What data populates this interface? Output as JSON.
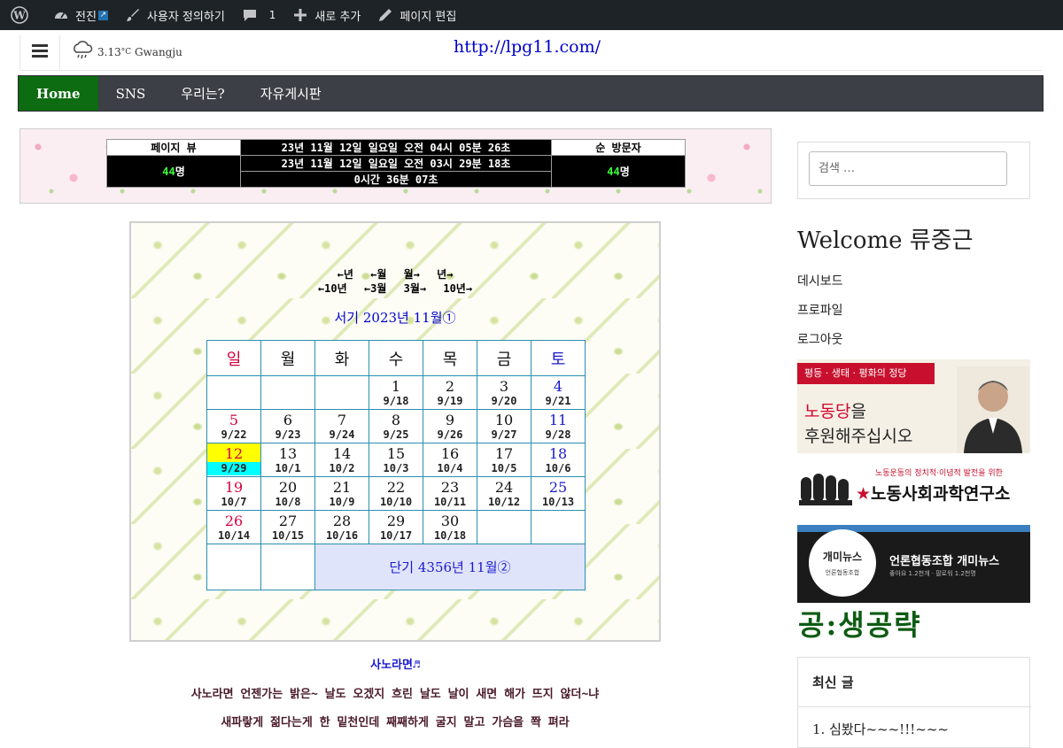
{
  "adminbar": {
    "site_name": "전진",
    "customize": "사용자 정의하기",
    "comments_count": "1",
    "new": "새로 추가",
    "edit_page": "페이지 편집"
  },
  "header": {
    "weather_temp": "3.13",
    "weather_unit": "°C",
    "weather_city": "Gwangju",
    "site_url": "http://lpg11.com/"
  },
  "nav": {
    "items": [
      {
        "label": "Home"
      },
      {
        "label": "SNS"
      },
      {
        "label": "우리는?"
      },
      {
        "label": "자유게시판"
      }
    ]
  },
  "counter": {
    "pageview_label": "페이지 뷰",
    "pageview_value": "44",
    "unit": "명",
    "now_time": "23년 11월 12일 일요일 오전 04시 05분 26초",
    "start_time": "23년 11월 12일 일요일 오전 03시 29분 18초",
    "elapsed": "0시간 36분 07초",
    "visitors_label": "순 방문자",
    "visitors_value": "44"
  },
  "calendar": {
    "nav_row1": [
      "←년",
      "←월",
      "월→",
      "년→"
    ],
    "nav_row2": [
      "←10년",
      "←3월",
      "3월→",
      "10년→"
    ],
    "title": "서기 2023년 11월①",
    "weekdays": [
      "일",
      "월",
      "화",
      "수",
      "목",
      "금",
      "토"
    ],
    "weeks": [
      [
        null,
        null,
        null,
        [
          "1",
          "9/18"
        ],
        [
          "2",
          "9/19"
        ],
        [
          "3",
          "9/20"
        ],
        [
          "4",
          "9/21"
        ]
      ],
      [
        [
          "5",
          "9/22"
        ],
        [
          "6",
          "9/23"
        ],
        [
          "7",
          "9/24"
        ],
        [
          "8",
          "9/25"
        ],
        [
          "9",
          "9/26"
        ],
        [
          "10",
          "9/27"
        ],
        [
          "11",
          "9/28"
        ]
      ],
      [
        [
          "12",
          "9/29"
        ],
        [
          "13",
          "10/1"
        ],
        [
          "14",
          "10/2"
        ],
        [
          "15",
          "10/3"
        ],
        [
          "16",
          "10/4"
        ],
        [
          "17",
          "10/5"
        ],
        [
          "18",
          "10/6"
        ]
      ],
      [
        [
          "19",
          "10/7"
        ],
        [
          "20",
          "10/8"
        ],
        [
          "21",
          "10/9"
        ],
        [
          "22",
          "10/10"
        ],
        [
          "23",
          "10/11"
        ],
        [
          "24",
          "10/12"
        ],
        [
          "25",
          "10/13"
        ]
      ],
      [
        [
          "26",
          "10/14"
        ],
        [
          "27",
          "10/15"
        ],
        [
          "28",
          "10/16"
        ],
        [
          "29",
          "10/17"
        ],
        [
          "30",
          "10/18"
        ],
        null,
        null
      ]
    ],
    "today": "12",
    "dangi": "단기 4356년 11월②"
  },
  "lyrics": {
    "title": "사노라면♬",
    "line1": "사노라면 언젠가는 밝은~ 날도 오겠지 흐린 날도 날이 새면 해가 뜨지 않더~냐",
    "line2": "새파랗게 젊다는게 한 밑천인데 째째하게 굴지 말고 가슴을 쫙 펴라"
  },
  "sidebar": {
    "search_placeholder": "검색 …",
    "welcome": "Welcome 류중근",
    "links": [
      "데시보드",
      "프로파일",
      "로그아웃"
    ],
    "banner1": {
      "top": "평등 · 생태 · 평화의 정당",
      "line1a": "노동당",
      "line1b": "을",
      "line2": "후원해주십시오"
    },
    "banner2": {
      "small": "노동운동의 정치적·이념적 발전을 위한",
      "big": "노동사회과학연구소"
    },
    "banner3": {
      "logo": "개미뉴스",
      "sub": "언론협동조합",
      "title": "언론협동조합 개미뉴스",
      "small": "좋아요 1.2천개 · 팔로워 1.2천명"
    },
    "gongsaeng": "공:생공략",
    "recent_title": "최신 글",
    "recent_item": "1. 심봤다~~~!!!~~~"
  }
}
